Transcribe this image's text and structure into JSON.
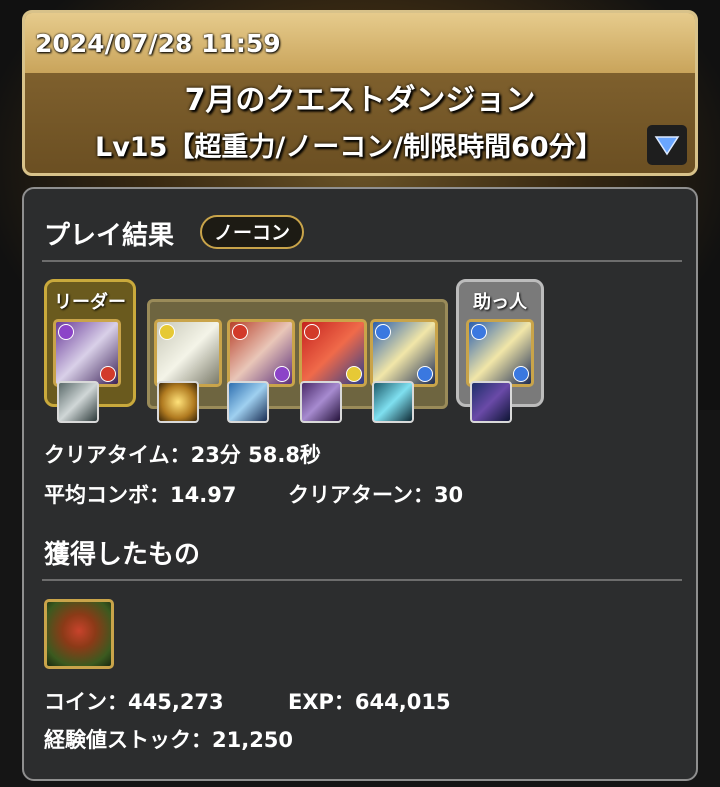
{
  "header": {
    "datetime": "2024/07/28 11:59",
    "title": "7月のクエストダンジョン",
    "subtitle": "Lv15【超重力/ノーコン/制限時間60分】",
    "dropdown_icon": "triangle-down-icon"
  },
  "result": {
    "title": "プレイ結果",
    "badge": "ノーコン",
    "leader_label": "リーダー",
    "helper_label": "助っ人",
    "clear_time": "クリアタイム：23分 58.8秒",
    "avg_combo": "平均コンボ：14.97",
    "clear_turn": "クリアターン：30"
  },
  "rewards": {
    "title": "獲得したもの",
    "coin": "コイン：445,273",
    "exp": "EXP：644,015",
    "exp_stock": "経験値ストック：21,250"
  },
  "colors": {
    "accent_gold": "#c9a44a",
    "panel_bg": "#2c2d2e",
    "header_bg": "#8a6a34",
    "dropdown_blue": "#6aa6ff"
  }
}
